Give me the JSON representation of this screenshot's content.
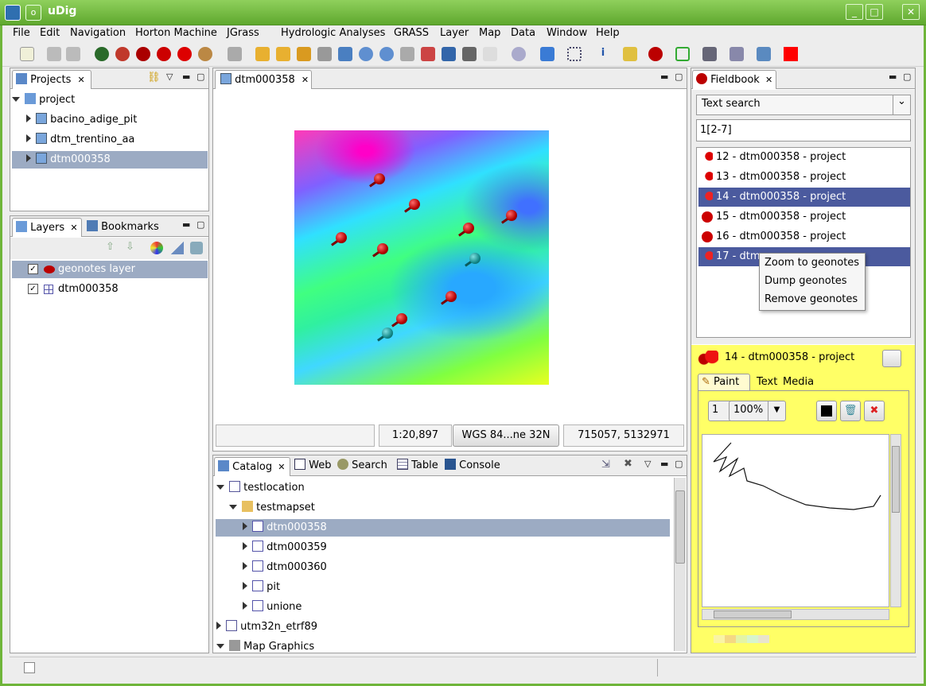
{
  "window": {
    "title": "uDig",
    "controls": [
      "_",
      "□",
      "✕"
    ]
  },
  "menu": [
    "File",
    "Edit",
    "Navigation",
    "Horton Machine",
    "JGrass",
    "Hydrologic Analyses",
    "GRASS",
    "Layer",
    "Map",
    "Data",
    "Window",
    "Help"
  ],
  "projects": {
    "tab_label": "Projects",
    "root": "project",
    "items": [
      "bacino_adige_pit",
      "dtm_trentino_aa",
      "dtm000358"
    ]
  },
  "layers": {
    "tab_label": "Layers",
    "bookmarks_label": "Bookmarks",
    "items": [
      "geonotes layer",
      "dtm000358"
    ]
  },
  "map": {
    "tab_label": "dtm000358",
    "scale": "1:20,897",
    "crs": "WGS 84...ne 32N",
    "coords": "715057, 5132971"
  },
  "catalog": {
    "tabs": [
      "Catalog",
      "Web",
      "Search",
      "Table",
      "Console"
    ],
    "items": [
      {
        "label": "testlocation"
      },
      {
        "label": "testmapset"
      },
      {
        "label": "dtm000358"
      },
      {
        "label": "dtm000359"
      },
      {
        "label": "dtm000360"
      },
      {
        "label": "pit"
      },
      {
        "label": "unione"
      },
      {
        "label": "utm32n_etrf89"
      },
      {
        "label": "Map Graphics"
      }
    ]
  },
  "fieldbook": {
    "tab_label": "Fieldbook",
    "search_mode": "Text search",
    "search_value": "1[2-7]",
    "notes": [
      "12 - dtm000358 - project",
      "13 - dtm000358 - project",
      "14 - dtm000358 - project",
      "15 - dtm000358 - project",
      "16 - dtm000358 - project",
      "17 - dtm"
    ],
    "context_menu": [
      "Zoom to geonotes",
      "Dump geonotes",
      "Remove geonotes"
    ],
    "detail_title": "14 - dtm000358 - project",
    "detail_tabs": [
      "Paint",
      "Text",
      "Media"
    ],
    "stroke_width": "1",
    "zoom": "100%",
    "colors": {
      "accent": "#ffff66",
      "selection": "#4b5a9e",
      "tree_selection": "#9cabc3"
    }
  }
}
